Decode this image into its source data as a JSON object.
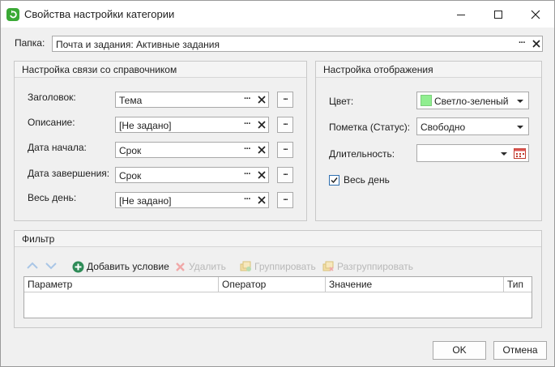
{
  "window": {
    "title": "Свойства настройки категории"
  },
  "folder": {
    "label": "Папка:",
    "value": "Почта и задания: Активные задания"
  },
  "mapping": {
    "title": "Настройка связи со справочником",
    "rows": [
      {
        "label": "Заголовок:",
        "value": "Тема"
      },
      {
        "label": "Описание:",
        "value": "[Не задано]"
      },
      {
        "label": "Дата начала:",
        "value": "Срок"
      },
      {
        "label": "Дата завершения:",
        "value": "Срок"
      },
      {
        "label": "Весь день:",
        "value": "[Не задано]"
      }
    ],
    "browse_label": "...",
    "dots_label": "···"
  },
  "display": {
    "title": "Настройка отображения",
    "color_label": "Цвет:",
    "color_value": "Светло-зеленый",
    "color_swatch": "#90ee90",
    "status_label": "Пометка (Статус):",
    "status_value": "Свободно",
    "duration_label": "Длительность:",
    "duration_value": "",
    "allday_label": "Весь день",
    "allday_checked": true
  },
  "filter": {
    "title": "Фильтр",
    "toolbar": {
      "add": "Добавить условие",
      "delete": "Удалить",
      "group": "Группировать",
      "ungroup": "Разгруппировать"
    },
    "columns": [
      "Параметр",
      "Оператор",
      "Значение",
      "Тип"
    ]
  },
  "buttons": {
    "ok": "OK",
    "cancel": "Отмена"
  },
  "colors": {
    "accent": "#2f6fb0",
    "add_green": "#2e8b57",
    "app_green": "#3aa935"
  }
}
